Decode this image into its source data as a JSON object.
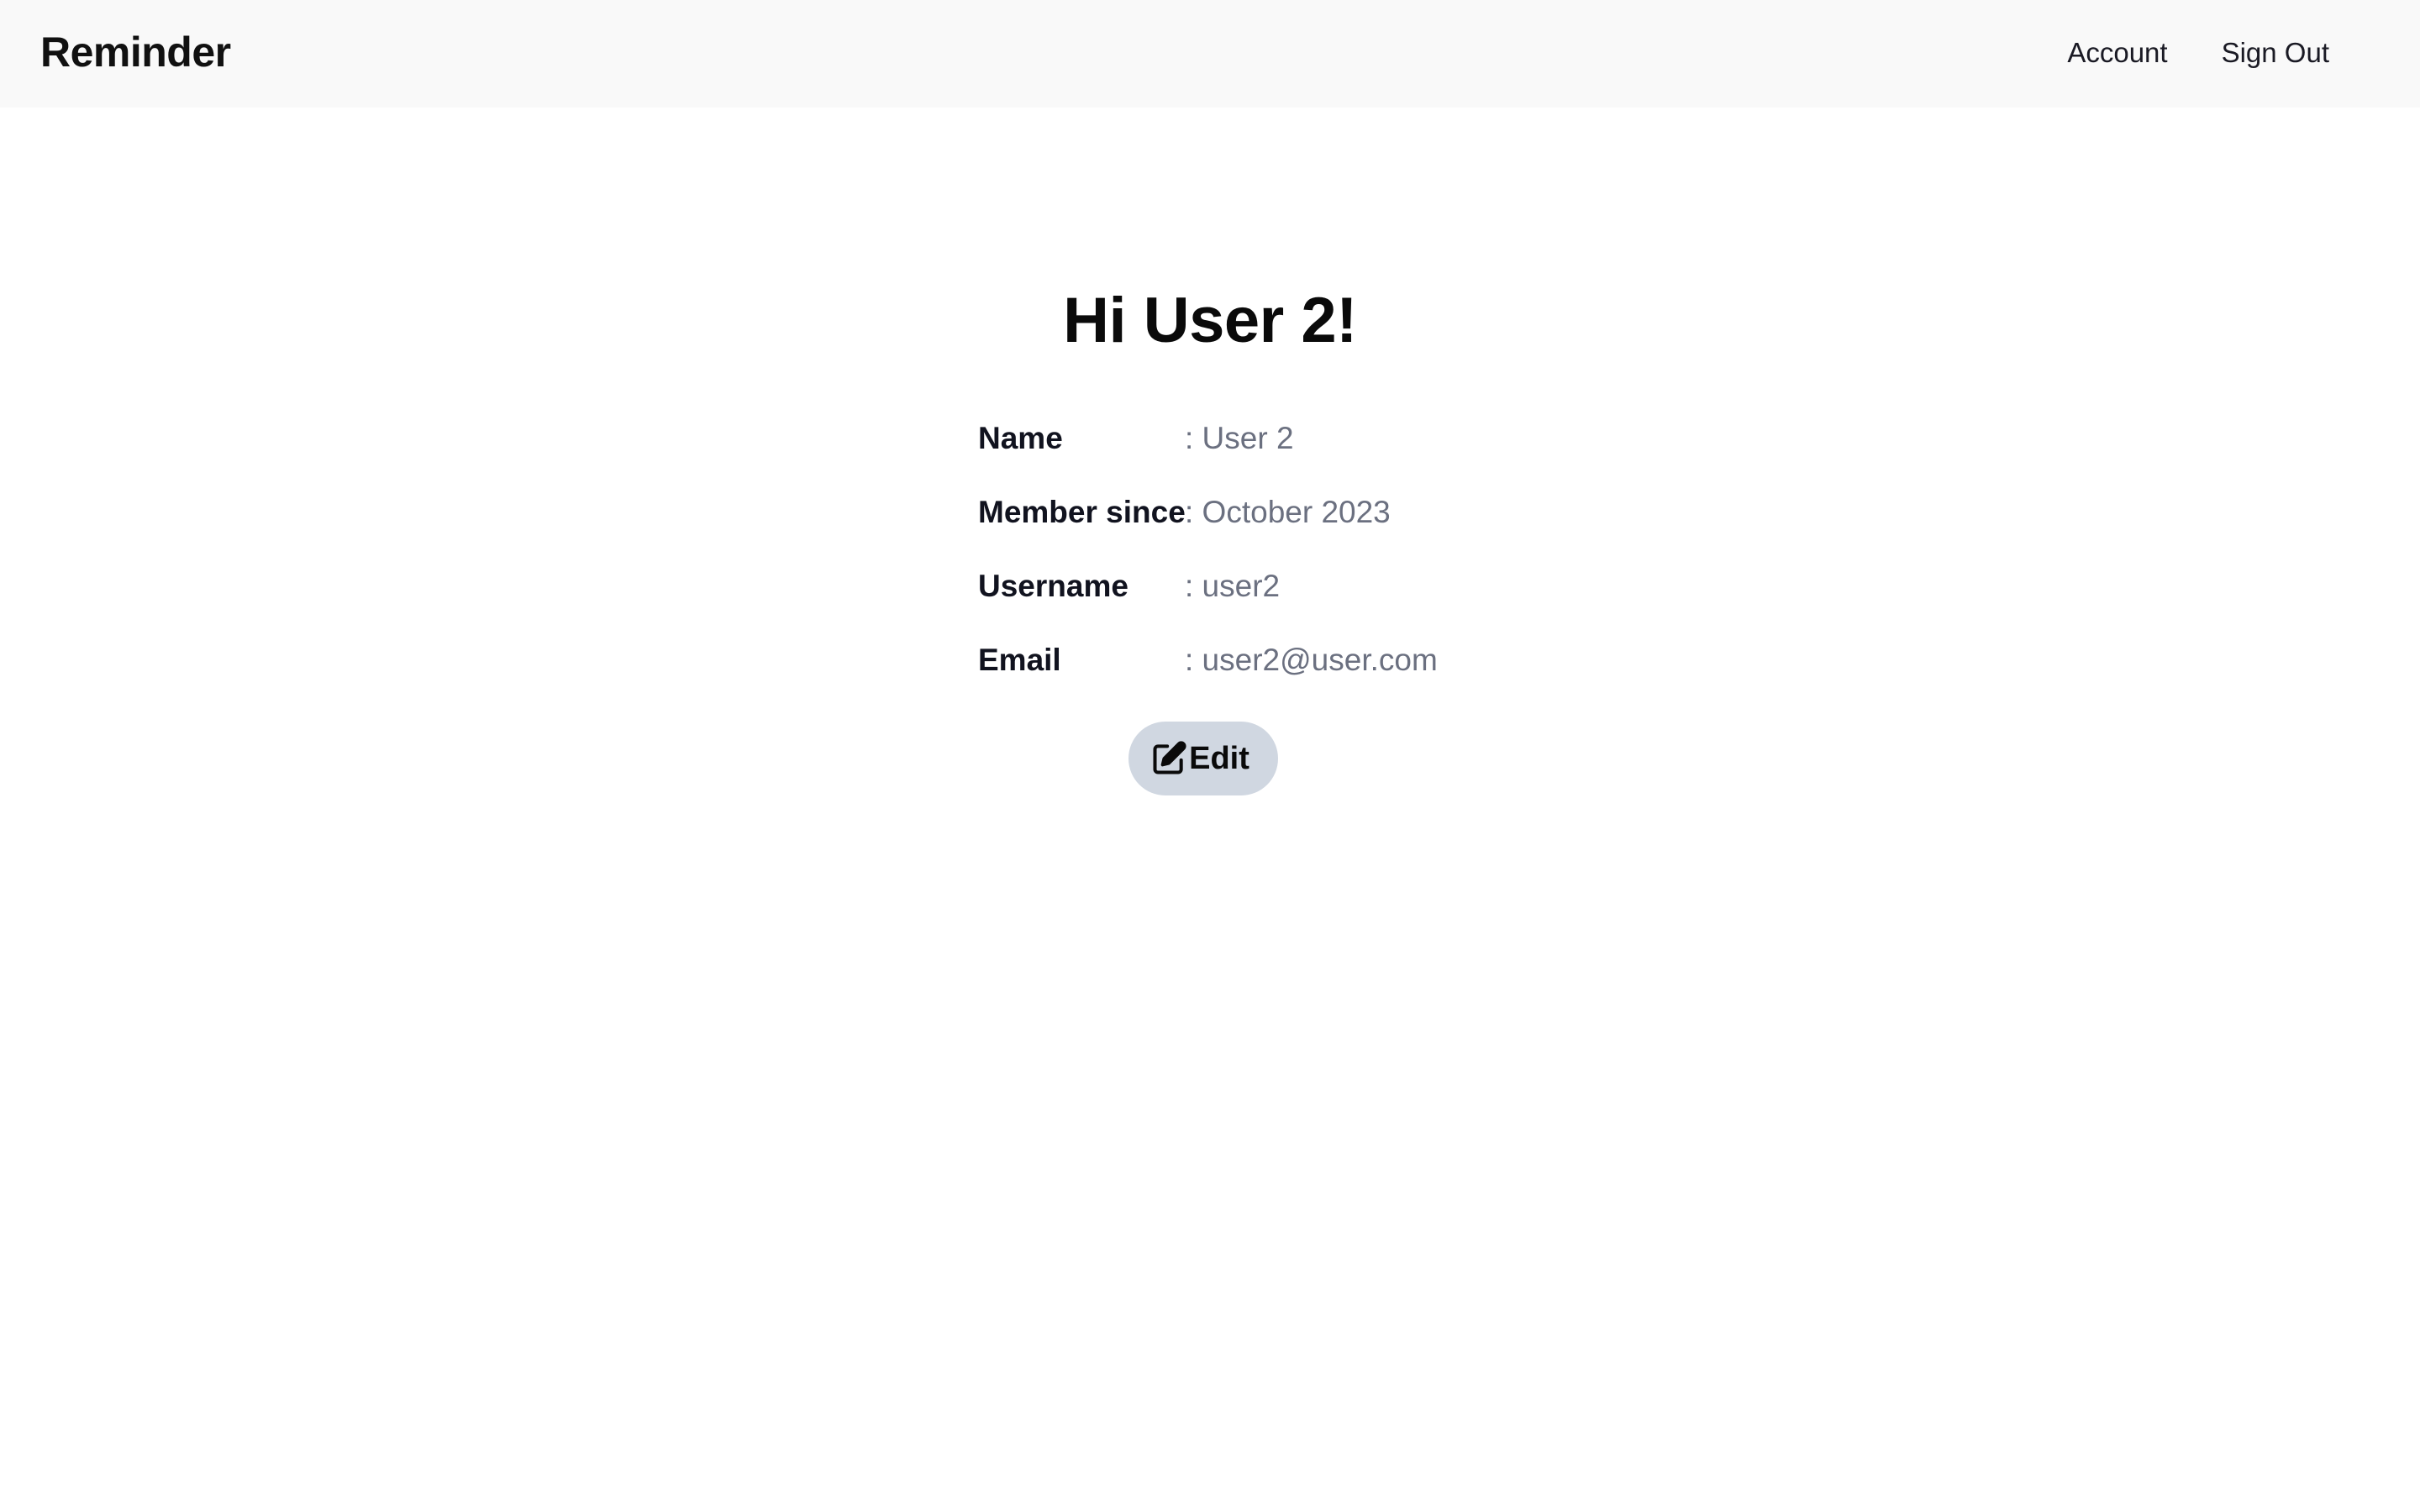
{
  "navbar": {
    "brand": "Reminder",
    "links": [
      {
        "label": "Account"
      },
      {
        "label": "Sign Out"
      }
    ]
  },
  "profile": {
    "greeting": "Hi User 2!",
    "fields": [
      {
        "label": "Name",
        "value": ": User 2"
      },
      {
        "label": "Member since",
        "value": ": October 2023"
      },
      {
        "label": "Username",
        "value": ": user2"
      },
      {
        "label": "Email",
        "value": ": user2@user.com"
      }
    ],
    "edit_button": {
      "label": "Edit",
      "icon": "edit-icon"
    }
  },
  "colors": {
    "navbar_bg": "#f9f9f9",
    "value_text": "#6b7080",
    "edit_button_bg": "#d0d7e1"
  }
}
